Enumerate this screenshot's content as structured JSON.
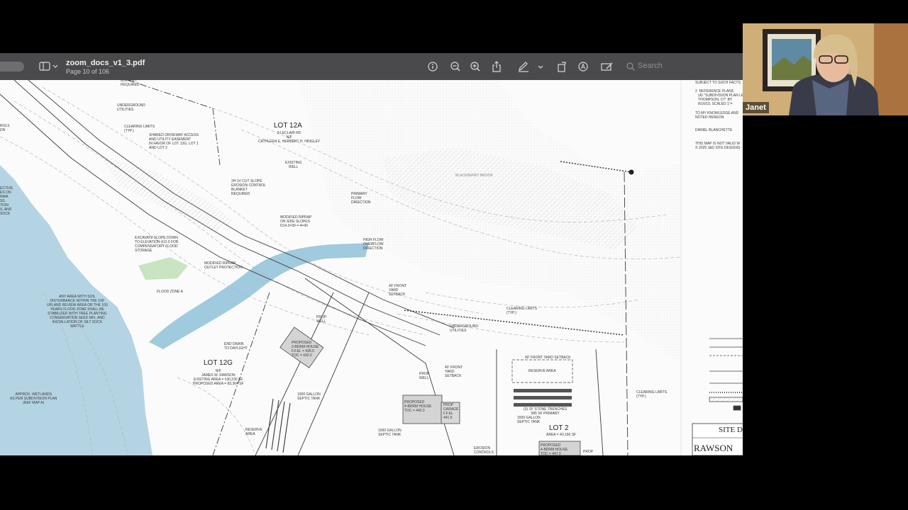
{
  "window": {
    "document_title": "zoom_docs_v1_3.pdf",
    "page_indicator": "Page 10 of 106",
    "search_placeholder": "Search"
  },
  "toolbar_icons": [
    "sidebar-icon",
    "info-icon",
    "zoom-out-icon",
    "zoom-in-icon",
    "share-icon",
    "markup-pen-icon",
    "rotate-icon",
    "annotate-icon",
    "edit-form-icon",
    "search-icon"
  ],
  "drawing": {
    "lot_labels": {
      "lot12a": "LOT 12A",
      "lot12g": "LOT 12G",
      "lot2": "LOT 2"
    },
    "lot12a_owner": "9 LECLAIR RD\nN/F\nCATHLEEN E. HERBERT H. HINGLEY",
    "lot12g_owner": "N/F\nJAMES W. RAWSON\nEXISTING AREA = ±30,230 SF\nPROPOSED AREA = 83,364 SF",
    "lot2_area": "AREA = 40,166 SF",
    "notes": {
      "blanket_required": "BLANKET\nREQUIRED",
      "underground_utilities": "UNDERGROUND\nUTILITIES",
      "clearing_limits_1": "CLEARING LIMITS\n(TYP.)",
      "shared_driveway": "SHARED DRIVEWAY ACCESS\nAND UTILITY EASEMENT\nIN FAVOR OF LOT 12G, LOT 1\nAND LOT 2",
      "existing_well": "EXISTING\nWELL",
      "cut_slope": "2H:1V CUT SLOPE\nEROSION CONTROL\nBLANKET\nREQUIRED",
      "primary_flow": "PRIMARY\nFLOW\nDIRECTION",
      "modified_riprap_slopes": "MODIFIED RIPRAP\nON SIDE SLOPES\nD14.3=30 = 4=40",
      "flood_zone_a": "FLOOD ZONE A",
      "high_flow": "HIGH FLOW\nOVERFLOW\nDIRECTION",
      "excavate_slope": "EXCAVATE SLOPE DOWN\nTO ELEVATION 412.0 FOR\nCOMPENSATORY FLOOD\nSTORAGE",
      "modified_riprap_outlet": "MODIFIED RIPRAP\nOUTLET PROTECTION",
      "front_setback_40": "40' FRONT\nYARD\nSETBACK",
      "any_area": "ANY AREA WITH SOIL\nDISTURBANCE WITHIN THE 100'\nUPLAND REVIEW AREA OR THE 100\nYEARS FLOOD ZONE SHALL BE\nSTABILIZED WITH TREE PLANTING\nCONSERVATION SEED MIX, AND\ninstallation OF SILT SOCK\nWATTLE",
      "clearing_limits_2": "CLEARING LIMITS\n(TYP.)",
      "underground_utilities_2": "UNDERGROUND\nUTILITIES",
      "front_yard_setback_top": "40' FRONT YARD SETBACK",
      "reserve_area": "RESERVE AREA",
      "stone_trenches": "(3) 15' STONE TRENCHES\n585 SF PRIMARY",
      "gallon_1500": "1500 GALLON\nSEPTIC TANK",
      "proposed_house_1": "PROPOSED\n3-BDRM HOUSE\nF.F.EL = 435.0\nTOC = 432.0",
      "prop_well": "PROP\nWELL",
      "end_drain": "END DRAIN\nTO DAYLIGHT",
      "gallon_1000a": "1000 GALLON\nSEPTIC TANK",
      "prop_garage": "PROP\nGARAGE\nF.F.EL\n441.5",
      "proposed_house_2": "PROPOSED\n4-BDRM HOUSE\nTOC = 442.0",
      "front_setback_40b": "40' FRONT\nYARD\nSETBACK",
      "prop_well_2": "PROP\nWELL",
      "approx_wetlands": "APPROX. WETLANDS\nAS PER SUBDIVISION PLAN\n(REF MAP A)",
      "reserve_area_2": "RESERVE\nAREA",
      "gallon_1000b": "1000 GALLON\nSEPTIC TANK",
      "erosion_controls": "EROSION\nCONTROLS",
      "proposed_house_3": "PROPOSED\n4-BDRM HOUSE\nTOC = 447.0",
      "prop_short": "PROP",
      "clearing_limits_3": "CLEARING LIMITS\n(TYP.)",
      "left_edge": "ECTIVE\nES ON\nNWA\nSS\nTION\nS, AND\nSOCK",
      "controls_left": "ROLS\nDN",
      "blackberry_brook": "BLACKBERRY BROOK"
    },
    "title_block": {
      "subject": "SUBJECT TO SUCH FACTS",
      "reference": "2  REFERENCE PLANS\n   (A) \"SUBDIVISION PLAN LE\n   THOMPSON, CT\" BY\n   8/16/10, SCALED 1\"=",
      "knowledge": "TO MY KNOWLEDGE AND\nNOTED HEREON",
      "signer": "DANIEL BLANCHETTE",
      "valid": "THIS MAP IS NOT VALID W\n© 2025 J&D SITE DESIGNS",
      "site": "SITE D",
      "rawson": "RAWSON"
    }
  },
  "participant": {
    "name": "Janet"
  }
}
